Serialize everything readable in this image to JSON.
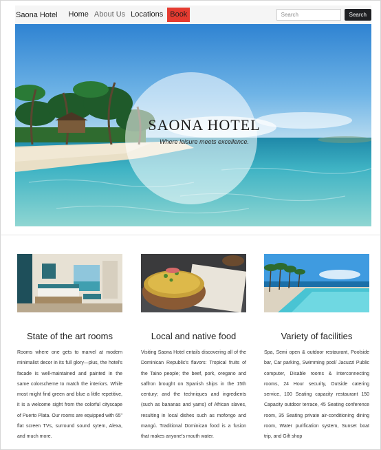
{
  "navbar": {
    "brand": "Saona Hotel",
    "links": [
      "Home",
      "About Us",
      "Locations"
    ],
    "book_label": "Book",
    "search_placeholder": "Search",
    "search_button": "Search"
  },
  "hero": {
    "title": "SAONA HOTEL",
    "tagline": "Where leisure meets excellence."
  },
  "features": [
    {
      "title": "State of the art rooms",
      "body": "Rooms where one gets to marvel at modern minimalist decor in its full glory—plus, the hotel's facade is well-maintained and painted in the same colorscheme to match the interiors. While most might find green and blue a little repetitive, it is a welcome sight from the colorful cityscape of Puerto Plata. Our rooms are equipped with 65\" flat screen TVs, surround sound sytem, Alexa, and much more."
    },
    {
      "title": "Local and native food",
      "body": "Visiting Saona Hotel entails discovering all of the Dominican Republic's flavors: Tropical fruits of the Taino people; the beef, pork, oregano and saffron brought on Spanish ships in the 15th century; and the techniques and ingredients (such as bananas and yams) of African slaves, resulting in local dishes such as mofongo and mangú. Traditional Dominican food is a fusion that makes anyone's mouth water."
    },
    {
      "title": "Variety of facilities",
      "body": "Spa, Semi open & outdoor restaurant, Poolside bar, Car parking, Swimming pool/ Jacuzzi Public computer, Disable rooms & Interconnecting rooms, 24 Hour security, Outside catering service, 100 Seating capacity restaurant 150 Capacity outdoor terrace, 45 Seating conference room, 35 Seating private air-conditioning dining room, Water purification system, Sunset boat trip, and Gift shop"
    }
  ],
  "colors": {
    "book_bg": "#e53b30",
    "search_button_bg": "#1f2023",
    "sky": "#2f8fd6",
    "sea": "#3fb3c4"
  }
}
